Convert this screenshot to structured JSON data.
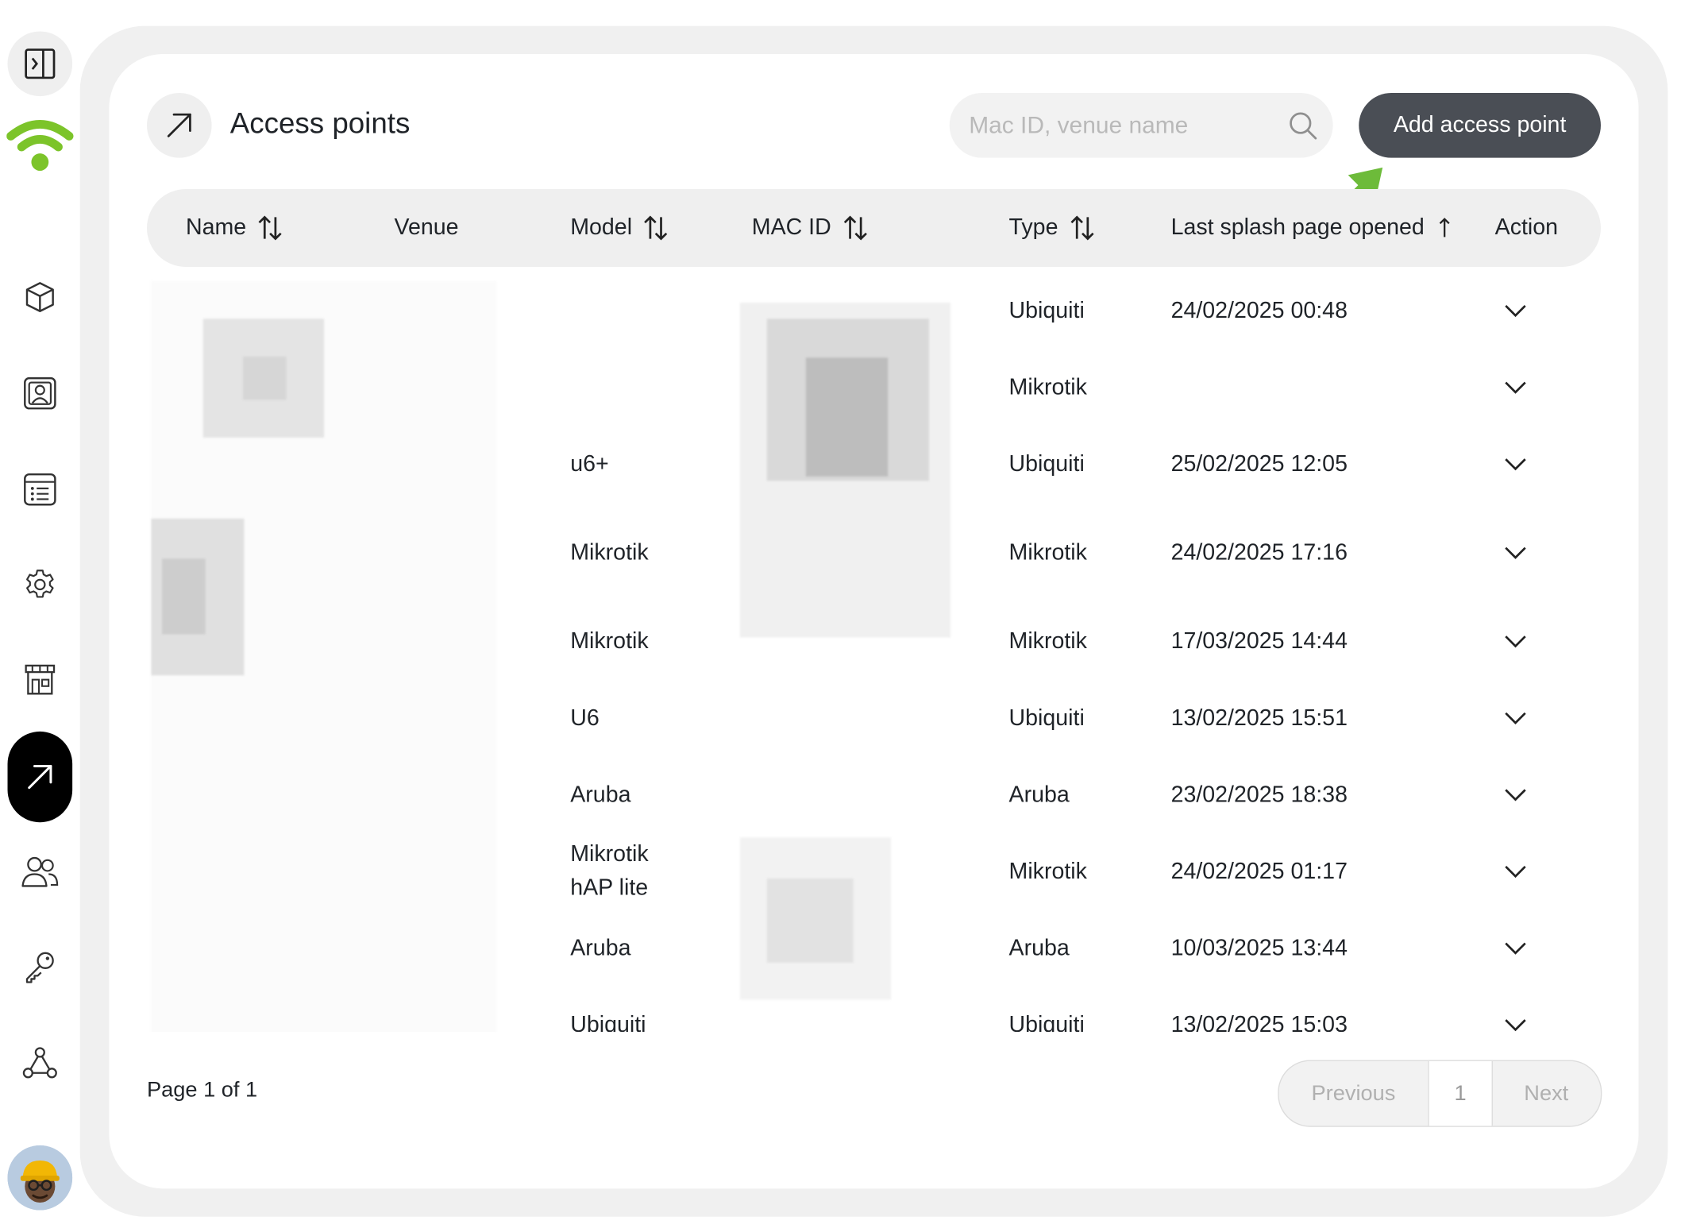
{
  "page": {
    "title": "Access points"
  },
  "search": {
    "placeholder": "Mac ID, venue name"
  },
  "toolbar": {
    "add_label": "Add access point"
  },
  "table": {
    "columns": {
      "name": "Name",
      "venue": "Venue",
      "model": "Model",
      "mac": "MAC ID",
      "type": "Type",
      "last_splash": "Last splash page opened",
      "action": "Action"
    },
    "rows": [
      {
        "model": "",
        "type": "Ubiquiti",
        "last_splash": "24/02/2025 00:48"
      },
      {
        "model": "",
        "type": "Mikrotik",
        "last_splash": ""
      },
      {
        "model": "u6+",
        "type": "Ubiquiti",
        "last_splash": "25/02/2025 12:05"
      },
      {
        "model": "Mikrotik",
        "type": "Mikrotik",
        "last_splash": "24/02/2025 17:16"
      },
      {
        "model": "Mikrotik",
        "type": "Mikrotik",
        "last_splash": "17/03/2025 14:44"
      },
      {
        "model": "U6",
        "type": "Ubiquiti",
        "last_splash": "13/02/2025 15:51"
      },
      {
        "model": "Aruba",
        "type": "Aruba",
        "last_splash": "23/02/2025 18:38"
      },
      {
        "model_line1": "Mikrotik",
        "model_line2": "hAP lite",
        "type": "Mikrotik",
        "last_splash": "24/02/2025 01:17"
      },
      {
        "model": "Aruba",
        "type": "Aruba",
        "last_splash": "10/03/2025 13:44"
      },
      {
        "model": "Ubiquiti",
        "type": "Ubiquiti",
        "last_splash": "13/02/2025 15:03"
      }
    ]
  },
  "pagination": {
    "info": "Page 1 of 1",
    "previous": "Previous",
    "current": "1",
    "next": "Next"
  },
  "colors": {
    "brand_green": "#7cc42a",
    "primary_button": "#4a4e55",
    "annotation_arrow": "#6dbb3a",
    "active_nav": "#000000"
  },
  "icons": {
    "sidebar": [
      "sidebar-toggle-icon",
      "wifi-logo-icon",
      "cube-icon",
      "contact-card-icon",
      "list-icon",
      "gear-icon",
      "store-icon",
      "arrow-up-right-icon",
      "users-icon",
      "key-icon",
      "webhook-icon"
    ],
    "title": "arrow-up-right-icon",
    "search": "search-icon",
    "row_action": "chevron-down-icon",
    "sort": "sort-arrows-icon"
  }
}
